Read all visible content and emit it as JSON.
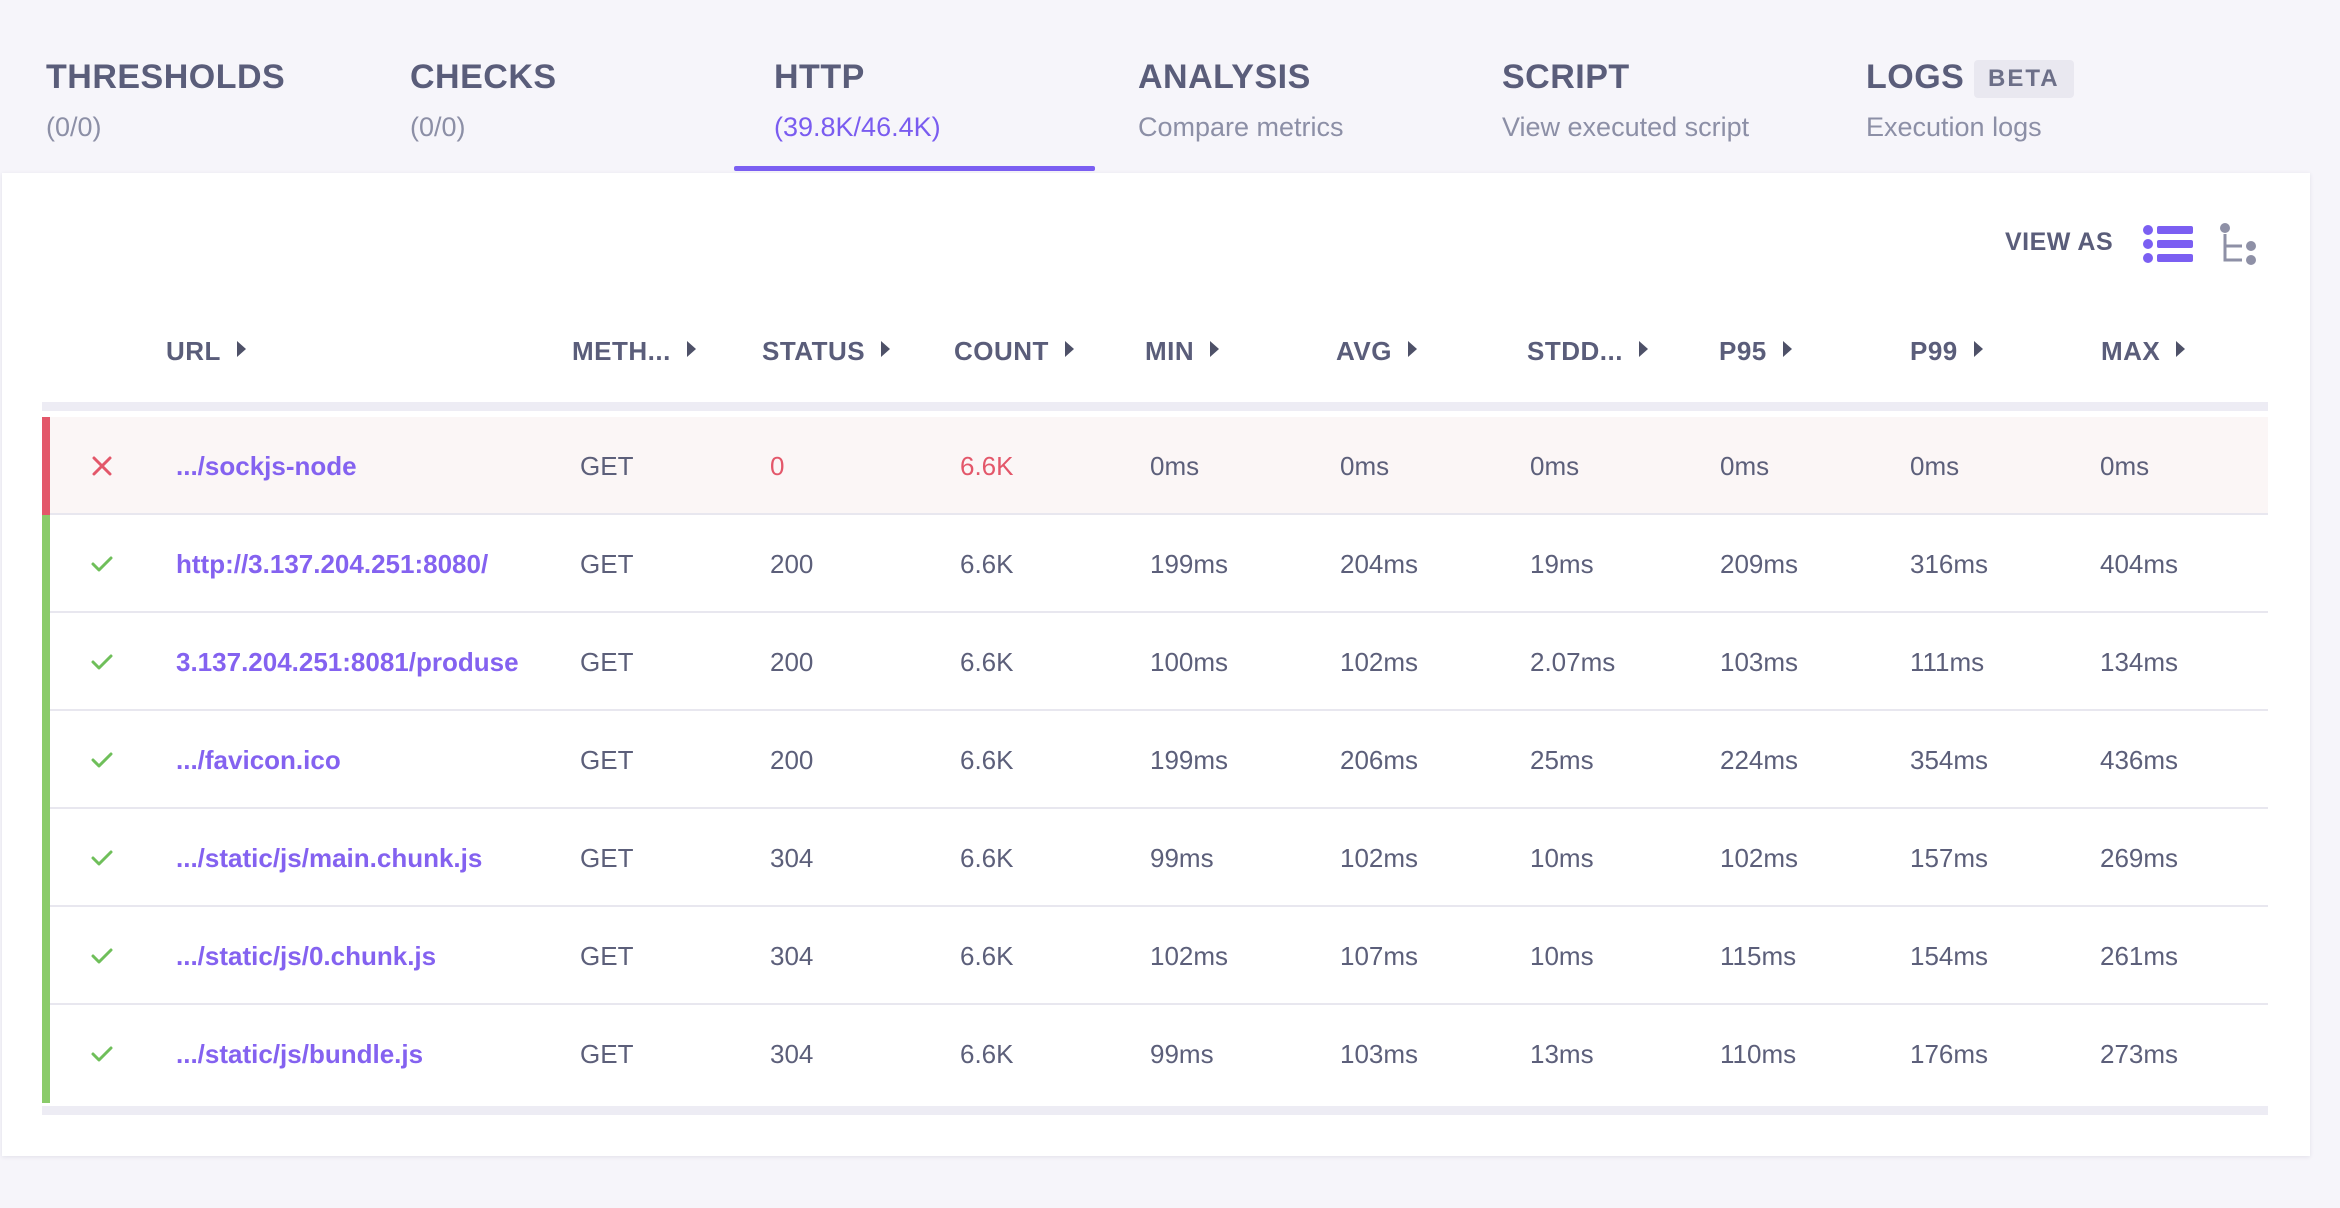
{
  "tabs": [
    {
      "title": "THRESHOLDS",
      "sub": "(0/0)"
    },
    {
      "title": "CHECKS",
      "sub": "(0/0)"
    },
    {
      "title": "HTTP",
      "sub": "(39.8K/46.4K)"
    },
    {
      "title": "ANALYSIS",
      "sub": "Compare metrics"
    },
    {
      "title": "SCRIPT",
      "sub": "View executed script"
    },
    {
      "title": "LOGS",
      "sub": "Execution logs",
      "badge": "BETA"
    }
  ],
  "active_tab": "HTTP",
  "view_as": {
    "label": "VIEW AS",
    "options": [
      "list-icon",
      "tree-icon"
    ],
    "selected": "list-icon"
  },
  "columns": [
    "URL",
    "METH...",
    "STATUS",
    "COUNT",
    "MIN",
    "AVG",
    "STDD...",
    "P95",
    "P99",
    "MAX"
  ],
  "rows": [
    {
      "ok": false,
      "url": ".../sockjs-node",
      "method": "GET",
      "status": "0",
      "count": "6.6K",
      "min": "0ms",
      "avg": "0ms",
      "stddev": "0ms",
      "p95": "0ms",
      "p99": "0ms",
      "max": "0ms"
    },
    {
      "ok": true,
      "url": "http://3.137.204.251:8080/",
      "method": "GET",
      "status": "200",
      "count": "6.6K",
      "min": "199ms",
      "avg": "204ms",
      "stddev": "19ms",
      "p95": "209ms",
      "p99": "316ms",
      "max": "404ms"
    },
    {
      "ok": true,
      "url": "3.137.204.251:8081/produse",
      "method": "GET",
      "status": "200",
      "count": "6.6K",
      "min": "100ms",
      "avg": "102ms",
      "stddev": "2.07ms",
      "p95": "103ms",
      "p99": "111ms",
      "max": "134ms"
    },
    {
      "ok": true,
      "url": ".../favicon.ico",
      "method": "GET",
      "status": "200",
      "count": "6.6K",
      "min": "199ms",
      "avg": "206ms",
      "stddev": "25ms",
      "p95": "224ms",
      "p99": "354ms",
      "max": "436ms"
    },
    {
      "ok": true,
      "url": ".../static/js/main.chunk.js",
      "method": "GET",
      "status": "304",
      "count": "6.6K",
      "min": "99ms",
      "avg": "102ms",
      "stddev": "10ms",
      "p95": "102ms",
      "p99": "157ms",
      "max": "269ms"
    },
    {
      "ok": true,
      "url": ".../static/js/0.chunk.js",
      "method": "GET",
      "status": "304",
      "count": "6.6K",
      "min": "102ms",
      "avg": "107ms",
      "stddev": "10ms",
      "p95": "115ms",
      "p99": "154ms",
      "max": "261ms"
    },
    {
      "ok": true,
      "url": ".../static/js/bundle.js",
      "method": "GET",
      "status": "304",
      "count": "6.6K",
      "min": "99ms",
      "avg": "103ms",
      "stddev": "13ms",
      "p95": "110ms",
      "p99": "176ms",
      "max": "273ms"
    }
  ],
  "colors": {
    "accent": "#7b5ff2",
    "error": "#e3576a",
    "success": "#8acb6a",
    "text": "#5c5f7a"
  }
}
